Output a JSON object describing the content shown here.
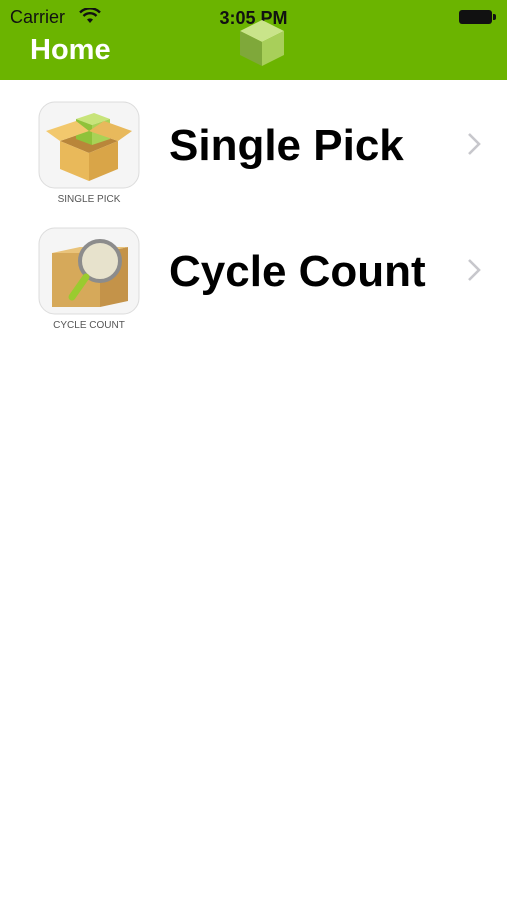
{
  "status_bar": {
    "carrier": "Carrier",
    "time": "3:05 PM"
  },
  "nav": {
    "title": "Home"
  },
  "items": [
    {
      "label": "Single Pick",
      "icon_caption": "SINGLE PICK",
      "icon": "open-box-icon"
    },
    {
      "label": "Cycle Count",
      "icon_caption": "CYCLE COUNT",
      "icon": "magnifier-box-icon"
    }
  ],
  "colors": {
    "nav_bg": "#6bb400",
    "chevron": "#c7c7cc"
  }
}
